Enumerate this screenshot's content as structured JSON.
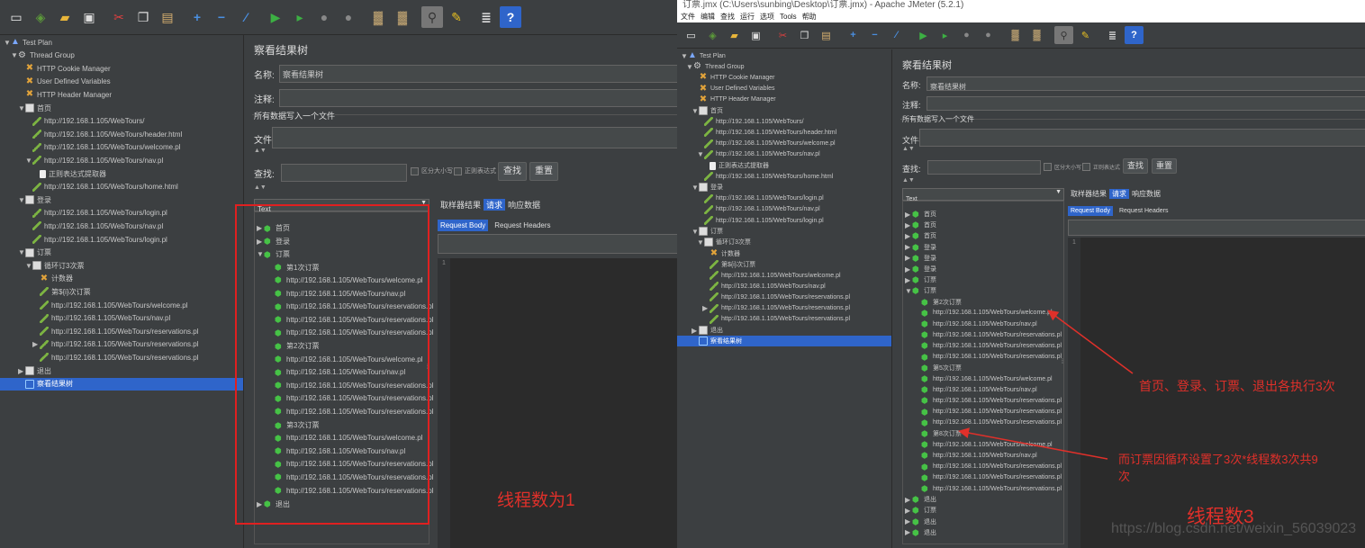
{
  "left": {
    "toolbar_icons": [
      "new-icon",
      "templates-icon",
      "open-icon",
      "save-icon",
      "cut-icon",
      "copy-icon",
      "paste-icon",
      "expand-icon",
      "collapse-icon",
      "toggle-icon",
      "start-icon",
      "start-no-pause-icon",
      "stop-icon",
      "shutdown-icon",
      "clear-icon",
      "clear-all-icon",
      "search-icon",
      "reset-search-icon",
      "function-helper-icon",
      "help-icon"
    ],
    "tree": [
      {
        "label": "Test Plan",
        "indent": 0,
        "icon": "tp",
        "arrow": "▼"
      },
      {
        "label": "Thread Group",
        "indent": 1,
        "icon": "tg",
        "arrow": "▼"
      },
      {
        "label": "HTTP Cookie Manager",
        "indent": 2,
        "icon": "cfg",
        "arrow": ""
      },
      {
        "label": "User Defined Variables",
        "indent": 2,
        "icon": "cfg",
        "arrow": ""
      },
      {
        "label": "HTTP Header Manager",
        "indent": 2,
        "icon": "cfg",
        "arrow": ""
      },
      {
        "label": "首页",
        "indent": 2,
        "icon": "ctl",
        "arrow": "▼"
      },
      {
        "label": "http://192.168.1.105/WebTours/",
        "indent": 3,
        "icon": "req",
        "arrow": ""
      },
      {
        "label": "http://192.168.1.105/WebTours/header.html",
        "indent": 3,
        "icon": "req",
        "arrow": ""
      },
      {
        "label": "http://192.168.1.105/WebTours/welcome.pl",
        "indent": 3,
        "icon": "req",
        "arrow": ""
      },
      {
        "label": "http://192.168.1.105/WebTours/nav.pl",
        "indent": 3,
        "icon": "req",
        "arrow": "▼"
      },
      {
        "label": "正则表达式提取器",
        "indent": 4,
        "icon": "ex",
        "arrow": ""
      },
      {
        "label": "http://192.168.1.105/WebTours/home.html",
        "indent": 3,
        "icon": "req",
        "arrow": ""
      },
      {
        "label": "登录",
        "indent": 2,
        "icon": "ctl",
        "arrow": "▼"
      },
      {
        "label": "http://192.168.1.105/WebTours/login.pl",
        "indent": 3,
        "icon": "req",
        "arrow": ""
      },
      {
        "label": "http://192.168.1.105/WebTours/nav.pl",
        "indent": 3,
        "icon": "req",
        "arrow": ""
      },
      {
        "label": "http://192.168.1.105/WebTours/login.pl",
        "indent": 3,
        "icon": "req",
        "arrow": ""
      },
      {
        "label": "订票",
        "indent": 2,
        "icon": "ctl",
        "arrow": "▼"
      },
      {
        "label": "循环订3次票",
        "indent": 3,
        "icon": "ctl",
        "arrow": "▼"
      },
      {
        "label": "计数器",
        "indent": 4,
        "icon": "cfg",
        "arrow": ""
      },
      {
        "label": "第${i}次订票",
        "indent": 4,
        "icon": "req",
        "arrow": ""
      },
      {
        "label": "http://192.168.1.105/WebTours/welcome.pl",
        "indent": 4,
        "icon": "req",
        "arrow": ""
      },
      {
        "label": "http://192.168.1.105/WebTours/nav.pl",
        "indent": 4,
        "icon": "req",
        "arrow": ""
      },
      {
        "label": "http://192.168.1.105/WebTours/reservations.pl",
        "indent": 4,
        "icon": "req",
        "arrow": ""
      },
      {
        "label": "http://192.168.1.105/WebTours/reservations.pl",
        "indent": 4,
        "icon": "req",
        "arrow": "▶"
      },
      {
        "label": "http://192.168.1.105/WebTours/reservations.pl",
        "indent": 4,
        "icon": "req",
        "arrow": ""
      },
      {
        "label": "退出",
        "indent": 2,
        "icon": "ctl",
        "arrow": "▶"
      },
      {
        "label": "察看结果树",
        "indent": 2,
        "icon": "list",
        "arrow": "",
        "selected": true
      }
    ],
    "title": "察看结果树",
    "name_label": "名称:",
    "name_value": "察看结果树",
    "comment_label": "注释:",
    "file_section": "所有数据写入一个文件",
    "filename_label": "文件名",
    "search_label": "查找:",
    "case_label": "区分大小写",
    "regex_label": "正则表达式",
    "search_btn": "查找",
    "reset_btn": "重置",
    "renderer": "Text",
    "tabs": [
      "取样器结果",
      "请求",
      "响应数据"
    ],
    "active_tab": 1,
    "subtabs": [
      "Request Body",
      "Request Headers"
    ],
    "line_number": "1",
    "results": [
      {
        "label": "首页",
        "indent": 0,
        "arrow": "▶"
      },
      {
        "label": "登录",
        "indent": 0,
        "arrow": "▶"
      },
      {
        "label": "订票",
        "indent": 0,
        "arrow": "▼"
      },
      {
        "label": "第1次订票",
        "indent": 1,
        "arrow": ""
      },
      {
        "label": "http://192.168.1.105/WebTours/welcome.pl",
        "indent": 1,
        "arrow": ""
      },
      {
        "label": "http://192.168.1.105/WebTours/nav.pl",
        "indent": 1,
        "arrow": ""
      },
      {
        "label": "http://192.168.1.105/WebTours/reservations.pl",
        "indent": 1,
        "arrow": ""
      },
      {
        "label": "http://192.168.1.105/WebTours/reservations.pl",
        "indent": 1,
        "arrow": ""
      },
      {
        "label": "http://192.168.1.105/WebTours/reservations.pl",
        "indent": 1,
        "arrow": ""
      },
      {
        "label": "第2次订票",
        "indent": 1,
        "arrow": ""
      },
      {
        "label": "http://192.168.1.105/WebTours/welcome.pl",
        "indent": 1,
        "arrow": ""
      },
      {
        "label": "http://192.168.1.105/WebTours/nav.pl",
        "indent": 1,
        "arrow": ""
      },
      {
        "label": "http://192.168.1.105/WebTours/reservations.pl",
        "indent": 1,
        "arrow": ""
      },
      {
        "label": "http://192.168.1.105/WebTours/reservations.pl",
        "indent": 1,
        "arrow": ""
      },
      {
        "label": "http://192.168.1.105/WebTours/reservations.pl",
        "indent": 1,
        "arrow": ""
      },
      {
        "label": "第3次订票",
        "indent": 1,
        "arrow": ""
      },
      {
        "label": "http://192.168.1.105/WebTours/welcome.pl",
        "indent": 1,
        "arrow": ""
      },
      {
        "label": "http://192.168.1.105/WebTours/nav.pl",
        "indent": 1,
        "arrow": ""
      },
      {
        "label": "http://192.168.1.105/WebTours/reservations.pl",
        "indent": 1,
        "arrow": ""
      },
      {
        "label": "http://192.168.1.105/WebTours/reservations.pl",
        "indent": 1,
        "arrow": ""
      },
      {
        "label": "http://192.168.1.105/WebTours/reservations.pl",
        "indent": 1,
        "arrow": ""
      },
      {
        "label": "退出",
        "indent": 0,
        "arrow": "▶"
      }
    ],
    "annotation": "线程数为1"
  },
  "right": {
    "window_title": "订票.jmx (C:\\Users\\sunbing\\Desktop\\订票.jmx) - Apache JMeter (5.2.1)",
    "menu": [
      "文件",
      "编辑",
      "查找",
      "运行",
      "选项",
      "Tools",
      "帮助"
    ],
    "tree": [
      {
        "label": "Test Plan",
        "indent": 0,
        "icon": "tp",
        "arrow": "▼"
      },
      {
        "label": "Thread Group",
        "indent": 1,
        "icon": "tg",
        "arrow": "▼"
      },
      {
        "label": "HTTP Cookie Manager",
        "indent": 2,
        "icon": "cfg",
        "arrow": ""
      },
      {
        "label": "User Defined Variables",
        "indent": 2,
        "icon": "cfg",
        "arrow": ""
      },
      {
        "label": "HTTP Header Manager",
        "indent": 2,
        "icon": "cfg",
        "arrow": ""
      },
      {
        "label": "首页",
        "indent": 2,
        "icon": "ctl",
        "arrow": "▼"
      },
      {
        "label": "http://192.168.1.105/WebTours/",
        "indent": 3,
        "icon": "req",
        "arrow": ""
      },
      {
        "label": "http://192.168.1.105/WebTours/header.html",
        "indent": 3,
        "icon": "req",
        "arrow": ""
      },
      {
        "label": "http://192.168.1.105/WebTours/welcome.pl",
        "indent": 3,
        "icon": "req",
        "arrow": ""
      },
      {
        "label": "http://192.168.1.105/WebTours/nav.pl",
        "indent": 3,
        "icon": "req",
        "arrow": "▼"
      },
      {
        "label": "正则表达式提取器",
        "indent": 4,
        "icon": "ex",
        "arrow": ""
      },
      {
        "label": "http://192.168.1.105/WebTours/home.html",
        "indent": 3,
        "icon": "req",
        "arrow": ""
      },
      {
        "label": "登录",
        "indent": 2,
        "icon": "ctl",
        "arrow": "▼"
      },
      {
        "label": "http://192.168.1.105/WebTours/login.pl",
        "indent": 3,
        "icon": "req",
        "arrow": ""
      },
      {
        "label": "http://192.168.1.105/WebTours/nav.pl",
        "indent": 3,
        "icon": "req",
        "arrow": ""
      },
      {
        "label": "http://192.168.1.105/WebTours/login.pl",
        "indent": 3,
        "icon": "req",
        "arrow": ""
      },
      {
        "label": "订票",
        "indent": 2,
        "icon": "ctl",
        "arrow": "▼"
      },
      {
        "label": "循环订3次票",
        "indent": 3,
        "icon": "ctl",
        "arrow": "▼"
      },
      {
        "label": "计数器",
        "indent": 4,
        "icon": "cfg",
        "arrow": ""
      },
      {
        "label": "第${i}次订票",
        "indent": 4,
        "icon": "req",
        "arrow": ""
      },
      {
        "label": "http://192.168.1.105/WebTours/welcome.pl",
        "indent": 4,
        "icon": "req",
        "arrow": ""
      },
      {
        "label": "http://192.168.1.105/WebTours/nav.pl",
        "indent": 4,
        "icon": "req",
        "arrow": ""
      },
      {
        "label": "http://192.168.1.105/WebTours/reservations.pl",
        "indent": 4,
        "icon": "req",
        "arrow": ""
      },
      {
        "label": "http://192.168.1.105/WebTours/reservations.pl",
        "indent": 4,
        "icon": "req",
        "arrow": "▶"
      },
      {
        "label": "http://192.168.1.105/WebTours/reservations.pl",
        "indent": 4,
        "icon": "req",
        "arrow": ""
      },
      {
        "label": "退出",
        "indent": 2,
        "icon": "ctl",
        "arrow": "▶"
      },
      {
        "label": "察看结果树",
        "indent": 2,
        "icon": "list",
        "arrow": "",
        "selected": true
      }
    ],
    "title": "察看结果树",
    "name_label": "名称:",
    "name_value": "察看结果树",
    "comment_label": "注释:",
    "file_section": "所有数据写入一个文件",
    "filename_label": "文件名",
    "search_label": "查找:",
    "case_label": "区分大小写",
    "regex_label": "正则表达式",
    "search_btn": "查找",
    "reset_btn": "重置",
    "renderer": "Text",
    "tabs": [
      "取样器结果",
      "请求",
      "响应数据"
    ],
    "active_tab": 1,
    "subtabs": [
      "Request Body",
      "Request Headers"
    ],
    "line_number": "1",
    "results": [
      {
        "label": "首页",
        "indent": 0,
        "arrow": "▶"
      },
      {
        "label": "首页",
        "indent": 0,
        "arrow": "▶"
      },
      {
        "label": "首页",
        "indent": 0,
        "arrow": "▶"
      },
      {
        "label": "登录",
        "indent": 0,
        "arrow": "▶"
      },
      {
        "label": "登录",
        "indent": 0,
        "arrow": "▶"
      },
      {
        "label": "登录",
        "indent": 0,
        "arrow": "▶"
      },
      {
        "label": "订票",
        "indent": 0,
        "arrow": "▶"
      },
      {
        "label": "订票",
        "indent": 0,
        "arrow": "▼"
      },
      {
        "label": "第2次订票",
        "indent": 1,
        "arrow": ""
      },
      {
        "label": "http://192.168.1.105/WebTours/welcome.pl",
        "indent": 1,
        "arrow": ""
      },
      {
        "label": "http://192.168.1.105/WebTours/nav.pl",
        "indent": 1,
        "arrow": ""
      },
      {
        "label": "http://192.168.1.105/WebTours/reservations.pl",
        "indent": 1,
        "arrow": ""
      },
      {
        "label": "http://192.168.1.105/WebTours/reservations.pl",
        "indent": 1,
        "arrow": ""
      },
      {
        "label": "http://192.168.1.105/WebTours/reservations.pl",
        "indent": 1,
        "arrow": ""
      },
      {
        "label": "第5次订票",
        "indent": 1,
        "arrow": ""
      },
      {
        "label": "http://192.168.1.105/WebTours/welcome.pl",
        "indent": 1,
        "arrow": ""
      },
      {
        "label": "http://192.168.1.105/WebTours/nav.pl",
        "indent": 1,
        "arrow": ""
      },
      {
        "label": "http://192.168.1.105/WebTours/reservations.pl",
        "indent": 1,
        "arrow": ""
      },
      {
        "label": "http://192.168.1.105/WebTours/reservations.pl",
        "indent": 1,
        "arrow": ""
      },
      {
        "label": "http://192.168.1.105/WebTours/reservations.pl",
        "indent": 1,
        "arrow": ""
      },
      {
        "label": "第8次订票",
        "indent": 1,
        "arrow": ""
      },
      {
        "label": "http://192.168.1.105/WebTours/welcome.pl",
        "indent": 1,
        "arrow": ""
      },
      {
        "label": "http://192.168.1.105/WebTours/nav.pl",
        "indent": 1,
        "arrow": ""
      },
      {
        "label": "http://192.168.1.105/WebTours/reservations.pl",
        "indent": 1,
        "arrow": ""
      },
      {
        "label": "http://192.168.1.105/WebTours/reservations.pl",
        "indent": 1,
        "arrow": ""
      },
      {
        "label": "http://192.168.1.105/WebTours/reservations.pl",
        "indent": 1,
        "arrow": ""
      },
      {
        "label": "退出",
        "indent": 0,
        "arrow": "▶"
      },
      {
        "label": "订票",
        "indent": 0,
        "arrow": "▶"
      },
      {
        "label": "退出",
        "indent": 0,
        "arrow": "▶"
      },
      {
        "label": "退出",
        "indent": 0,
        "arrow": "▶"
      }
    ],
    "annotation1": "首页、登录、订票、退出各执行3次",
    "annotation2_line1": "而订票因循环设置了3次*线程数3次共9",
    "annotation2_line2": "次",
    "annotation3": "线程数3",
    "watermark": "https://blog.csdn.net/weixin_56039023"
  },
  "colors": {
    "annotation_red": "#e0302a",
    "selection_blue": "#2f65ca",
    "success_green": "#46c246"
  }
}
